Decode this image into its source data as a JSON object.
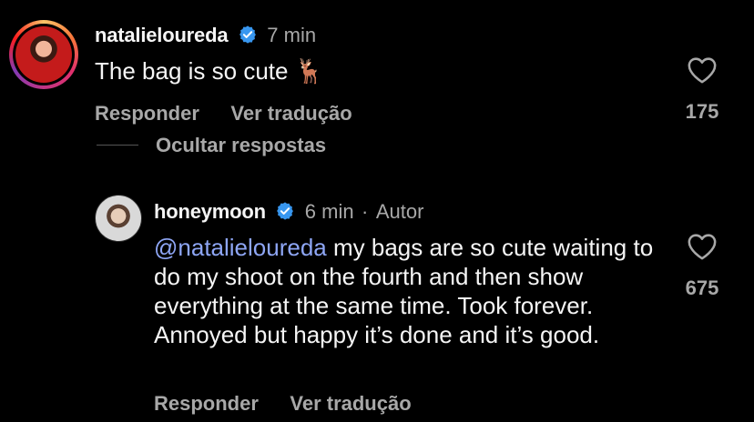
{
  "comment1": {
    "username": "natalieloureda",
    "time": "7 min",
    "text": "The bag is so cute 🦌",
    "reply_label": "Responder",
    "translate_label": "Ver tradução",
    "likes": "175"
  },
  "hide_replies_label": "Ocultar respostas",
  "comment2": {
    "username": "honeymoon",
    "time": "6 min",
    "separator": "·",
    "author_badge": "Autor",
    "mention": "@natalieloureda",
    "text": " my bags are so cute waiting to do my shoot on the fourth and then show everything at the same time. Took forever. Annoyed but happy it’s done and it’s good.",
    "reply_label": "Responder",
    "translate_label": "Ver tradução",
    "likes": "675"
  },
  "colors": {
    "background": "#000000",
    "text": "#f5f5f5",
    "muted": "#a8a8a8",
    "mention": "#8ea6f5",
    "verified": "#3897f0"
  }
}
